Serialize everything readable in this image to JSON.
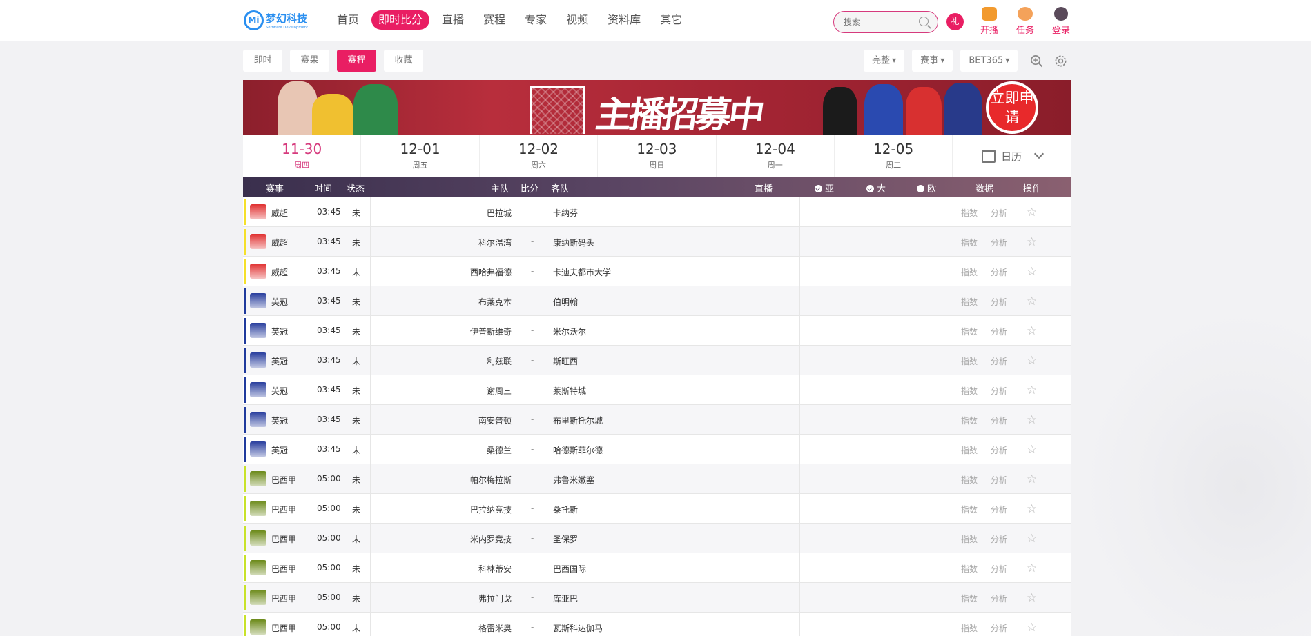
{
  "brand": {
    "name_cn": "梦幻科技",
    "name_en": "Software Development",
    "mark": "Mi"
  },
  "nav": [
    "首页",
    "即时比分",
    "直播",
    "赛程",
    "专家",
    "视频",
    "资料库",
    "其它"
  ],
  "search": {
    "placeholder": "搜索"
  },
  "top_actions": [
    {
      "label": "开播",
      "icon": "live-tv-icon"
    },
    {
      "label": "任务",
      "icon": "task-icon"
    },
    {
      "label": "登录",
      "icon": "user-icon"
    }
  ],
  "tabs": [
    "即时",
    "赛果",
    "赛程",
    "收藏"
  ],
  "active_tab": "赛程",
  "filters": [
    "完整",
    "赛事",
    "BET365"
  ],
  "banner": {
    "title": "主播招募中",
    "button": "立即申请"
  },
  "dates": [
    {
      "date": "11-30",
      "weekday": "周四",
      "active": true
    },
    {
      "date": "12-01",
      "weekday": "周五"
    },
    {
      "date": "12-02",
      "weekday": "周六"
    },
    {
      "date": "12-03",
      "weekday": "周日"
    },
    {
      "date": "12-04",
      "weekday": "周一"
    },
    {
      "date": "12-05",
      "weekday": "周二"
    }
  ],
  "calendar_label": "日历",
  "columns": {
    "league": "赛事",
    "time": "时间",
    "status": "状态",
    "home": "主队",
    "score": "比分",
    "away": "客队",
    "live": "直播",
    "asia": "亚",
    "big": "大",
    "euro": "欧",
    "data": "数据",
    "ops": "操作"
  },
  "row_actions": {
    "index": "指数",
    "analysis": "分析"
  },
  "matches": [
    {
      "league": "威超",
      "time": "03:45",
      "status": "未",
      "home": "巴拉城",
      "score": "-",
      "away": "卡纳芬",
      "color": "#f5e02a",
      "logo": "#e03030"
    },
    {
      "league": "威超",
      "time": "03:45",
      "status": "未",
      "home": "科尔温湾",
      "score": "-",
      "away": "康纳斯码头",
      "color": "#f5e02a",
      "logo": "#e03030"
    },
    {
      "league": "威超",
      "time": "03:45",
      "status": "未",
      "home": "西哈弗福德",
      "score": "-",
      "away": "卡迪夫都市大学",
      "color": "#f5e02a",
      "logo": "#e03030"
    },
    {
      "league": "英冠",
      "time": "03:45",
      "status": "未",
      "home": "布莱克本",
      "score": "-",
      "away": "伯明翰",
      "color": "#1f3a9c",
      "logo": "#2a3f9e"
    },
    {
      "league": "英冠",
      "time": "03:45",
      "status": "未",
      "home": "伊普斯维奇",
      "score": "-",
      "away": "米尔沃尔",
      "color": "#1f3a9c",
      "logo": "#2a3f9e"
    },
    {
      "league": "英冠",
      "time": "03:45",
      "status": "未",
      "home": "利兹联",
      "score": "-",
      "away": "斯旺西",
      "color": "#1f3a9c",
      "logo": "#2a3f9e"
    },
    {
      "league": "英冠",
      "time": "03:45",
      "status": "未",
      "home": "谢周三",
      "score": "-",
      "away": "莱斯特城",
      "color": "#1f3a9c",
      "logo": "#2a3f9e"
    },
    {
      "league": "英冠",
      "time": "03:45",
      "status": "未",
      "home": "南安普顿",
      "score": "-",
      "away": "布里斯托尔城",
      "color": "#1f3a9c",
      "logo": "#2a3f9e"
    },
    {
      "league": "英冠",
      "time": "03:45",
      "status": "未",
      "home": "桑德兰",
      "score": "-",
      "away": "哈德斯菲尔德",
      "color": "#1f3a9c",
      "logo": "#2a3f9e"
    },
    {
      "league": "巴西甲",
      "time": "05:00",
      "status": "未",
      "home": "帕尔梅拉斯",
      "score": "-",
      "away": "弗鲁米嫩塞",
      "color": "#c8e22a",
      "logo": "#6c8a1a"
    },
    {
      "league": "巴西甲",
      "time": "05:00",
      "status": "未",
      "home": "巴拉纳竞技",
      "score": "-",
      "away": "桑托斯",
      "color": "#c8e22a",
      "logo": "#6c8a1a"
    },
    {
      "league": "巴西甲",
      "time": "05:00",
      "status": "未",
      "home": "米内罗竞技",
      "score": "-",
      "away": "圣保罗",
      "color": "#c8e22a",
      "logo": "#6c8a1a"
    },
    {
      "league": "巴西甲",
      "time": "05:00",
      "status": "未",
      "home": "科林蒂安",
      "score": "-",
      "away": "巴西国际",
      "color": "#c8e22a",
      "logo": "#6c8a1a"
    },
    {
      "league": "巴西甲",
      "time": "05:00",
      "status": "未",
      "home": "弗拉门戈",
      "score": "-",
      "away": "库亚巴",
      "color": "#c8e22a",
      "logo": "#6c8a1a"
    },
    {
      "league": "巴西甲",
      "time": "05:00",
      "status": "未",
      "home": "格雷米奥",
      "score": "-",
      "away": "瓦斯科达伽马",
      "color": "#c8e22a",
      "logo": "#6c8a1a"
    }
  ]
}
